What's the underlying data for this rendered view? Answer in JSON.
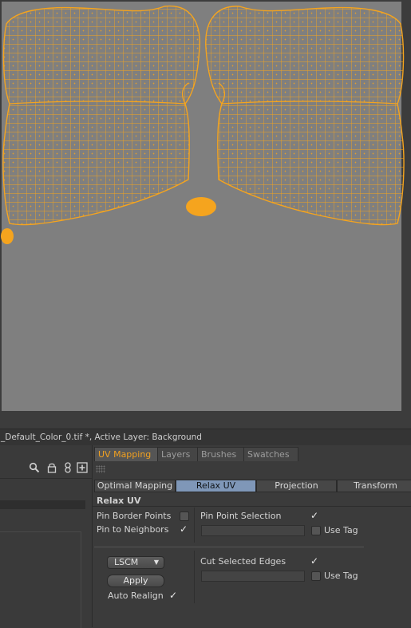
{
  "status_bar": {
    "text": "_Default_Color_0.tif *, Active Layer: Background"
  },
  "left_toolbar": {
    "icons": [
      "search-icon",
      "lock-icon",
      "link-icon",
      "add-layer-icon"
    ]
  },
  "panel_tabs": [
    {
      "label": "UV Mapping",
      "active": true
    },
    {
      "label": "Layers",
      "active": false
    },
    {
      "label": "Brushes",
      "active": false
    },
    {
      "label": "Swatches",
      "active": false
    }
  ],
  "sub_tabs": [
    {
      "label": "Optimal Mapping",
      "active": false
    },
    {
      "label": "Relax UV",
      "active": true
    },
    {
      "label": "Projection",
      "active": false
    },
    {
      "label": "Transform",
      "active": false
    }
  ],
  "relax_uv": {
    "title": "Relax UV",
    "pin_border_points": {
      "label": "Pin Border Points",
      "checked": false
    },
    "pin_to_neighbors": {
      "label": "Pin to Neighbors",
      "checked": true
    },
    "pin_point_selection": {
      "label": "Pin Point Selection",
      "checked": true,
      "value": ""
    },
    "use_tag_1": {
      "label": "Use Tag",
      "checked": false
    },
    "method": {
      "selected": "LSCM"
    },
    "apply_label": "Apply",
    "auto_realign": {
      "label": "Auto Realign",
      "checked": true
    },
    "cut_selected_edges": {
      "label": "Cut Selected Edges",
      "checked": true,
      "value": ""
    },
    "use_tag_2": {
      "label": "Use Tag",
      "checked": false
    }
  },
  "colors": {
    "uv_wire": "#f5a41e",
    "viewport_bg": "#7f7f7f",
    "active_tab_text": "#f0a020",
    "active_subtab_bg": "#7f97b8"
  }
}
